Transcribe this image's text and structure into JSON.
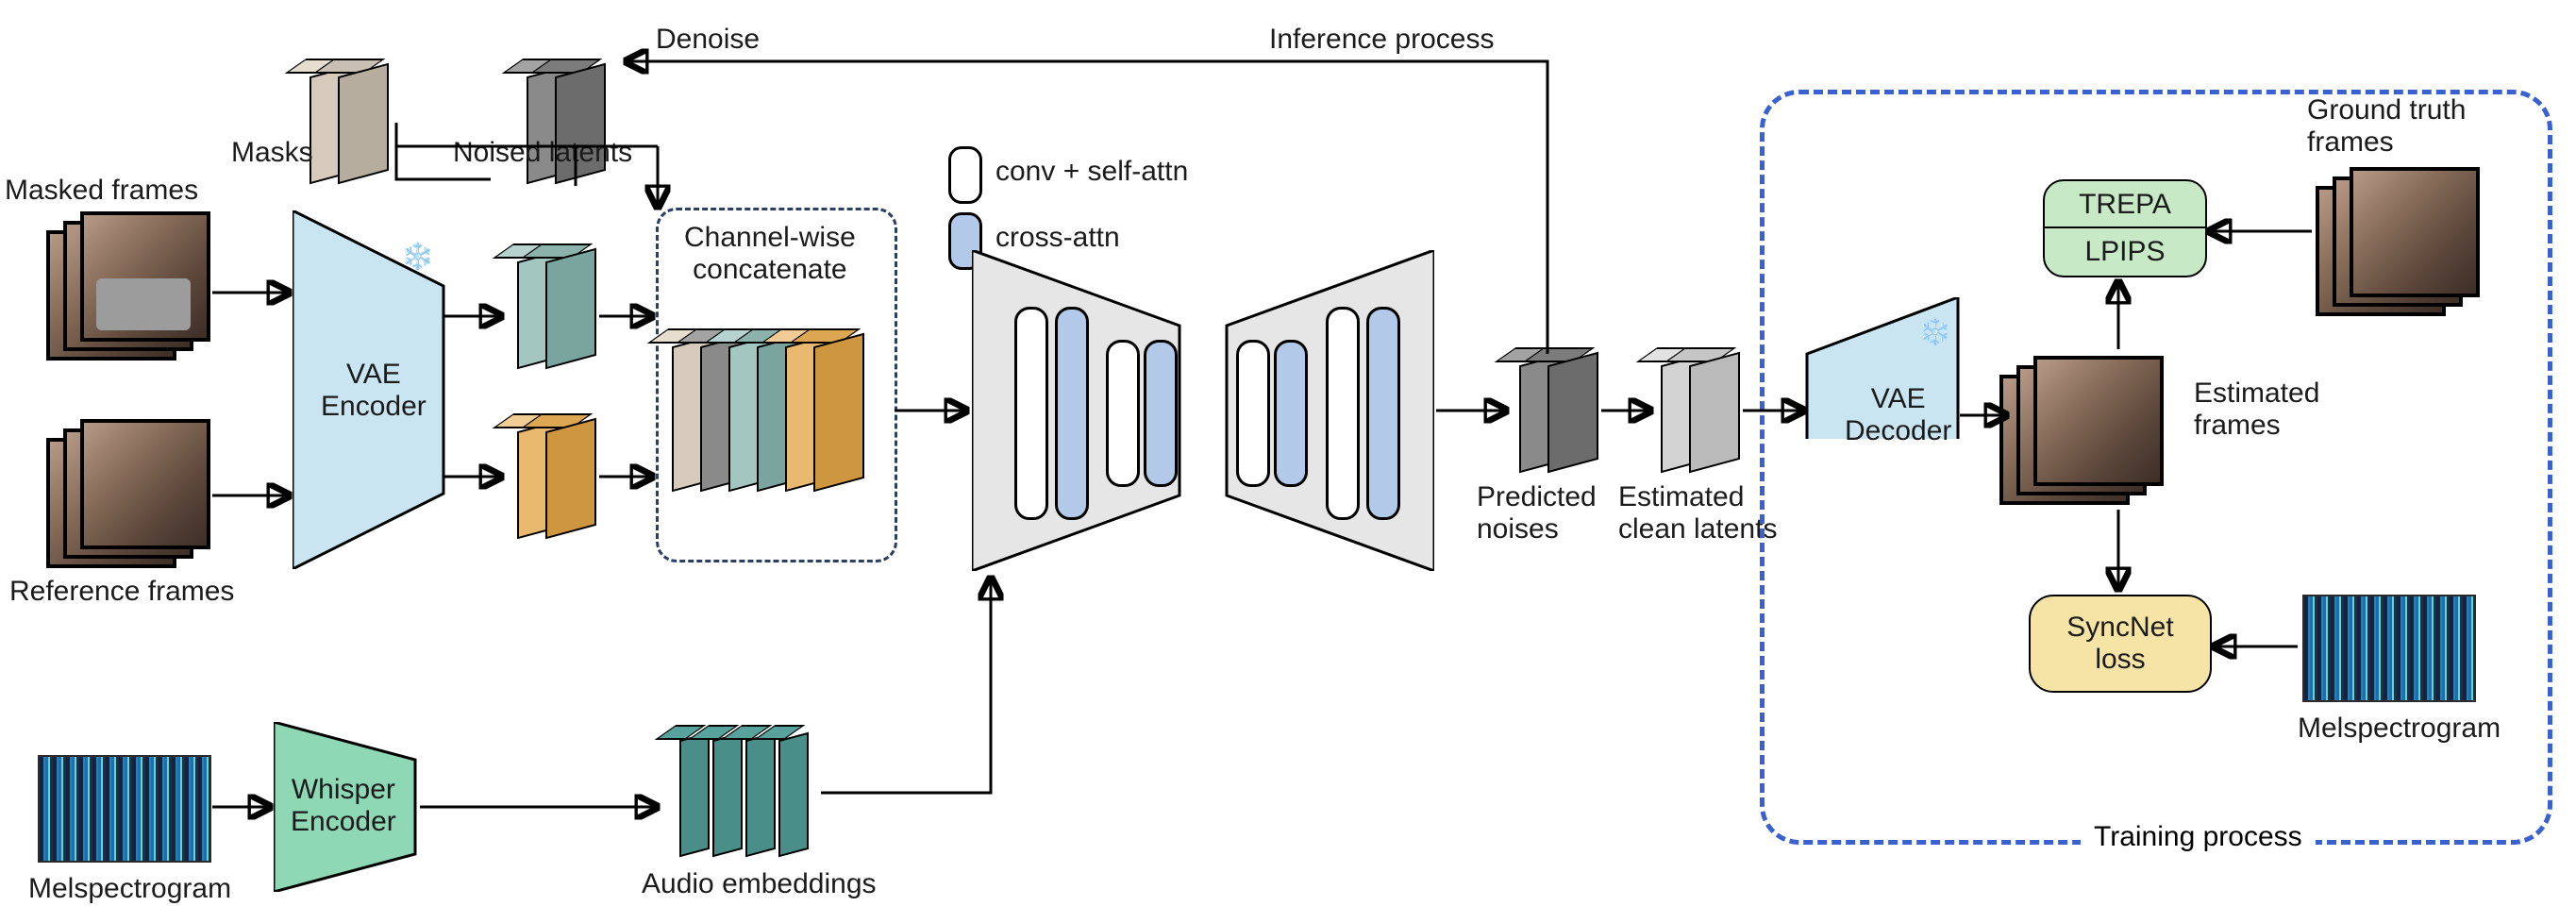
{
  "captions": {
    "masked_frames": "Masked frames",
    "reference_frames": "Reference frames",
    "mel_left": "Melspectrogram",
    "mel_right": "Melspectrogram",
    "masks": "Masks",
    "noised_latents": "Noised latents",
    "denoise": "Denoise",
    "inference_process": "Inference process",
    "vae_encoder": "VAE\nEncoder",
    "whisper_encoder": "Whisper\nEncoder",
    "channel_concat": "Channel-wise\nconcatenate",
    "audio_embeddings": "Audio embeddings",
    "predicted_noises": "Predicted\nnoises",
    "estimated_clean": "Estimated\nclean latents",
    "vae_decoder": "VAE\nDecoder",
    "estimated_frames": "Estimated\nframes",
    "ground_truth": "Ground truth\nframes",
    "training_process": "Training process",
    "trepa": "TREPA",
    "lpips": "LPIPS",
    "syncnet": "SyncNet\nloss",
    "legend_conv": "conv + self-attn",
    "legend_cross": "cross-attn"
  },
  "architecture": {
    "inputs": [
      "Masked frames",
      "Reference frames",
      "Melspectrogram"
    ],
    "frozen_modules": [
      "VAE Encoder",
      "VAE Decoder"
    ],
    "encoders": [
      "VAE Encoder",
      "Whisper Encoder"
    ],
    "latent_inputs": [
      "Masks",
      "Noised latents",
      "Masked-frame latents",
      "Reference-frame latents"
    ],
    "fuse_op": "Channel-wise concatenate",
    "backbone": "U-Net with conv+self-attn and cross-attn blocks",
    "cross_attn_condition": "Audio embeddings",
    "ddpm_output": "Predicted noises",
    "inference_loop": "Denoise Noised latents iteratively",
    "vae_decoder_input": "Estimated clean latents",
    "vae_decoder_output": "Estimated frames",
    "training_losses": [
      "TREPA",
      "LPIPS",
      "SyncNet loss"
    ],
    "loss_targets": {
      "TREPA": "Ground truth frames",
      "LPIPS": "Ground truth frames",
      "SyncNet loss": "Melspectrogram"
    }
  },
  "colors": {
    "vae": "#c9e5f2",
    "whisper": "#8fd8b6",
    "unet": "#e6e6e6",
    "cross_attn": "#b3c9ea",
    "trepa": "#c7e9c6",
    "syncnet": "#f6e4a6",
    "dashed_box": "#3a61d0",
    "plate_mask": "#d6cabc",
    "plate_noised": "#8a8a8a",
    "plate_ref": "#e9b96f",
    "plate_masked": "#a3c6c1"
  }
}
